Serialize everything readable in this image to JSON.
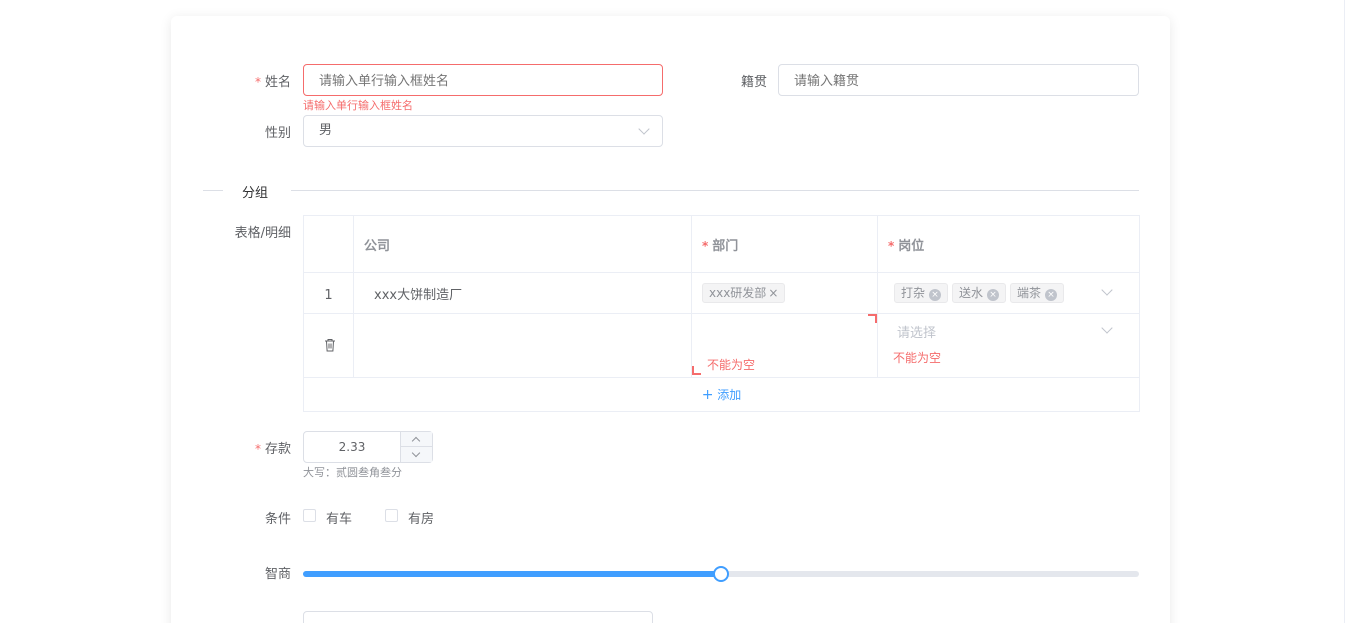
{
  "form": {
    "name": {
      "required_mark": "*",
      "label": "姓名",
      "placeholder": "请输入单行输入框姓名",
      "error": "请输入单行输入框姓名"
    },
    "hometown": {
      "label": "籍贯",
      "placeholder": "请输入籍贯"
    },
    "gender": {
      "label": "性别",
      "value": "男"
    },
    "group_divider": {
      "label": "分组"
    },
    "table": {
      "label": "表格/明细",
      "columns": [
        {
          "label": "公司",
          "required": false
        },
        {
          "label": "部门",
          "required": true,
          "required_mark": "*"
        },
        {
          "label": "岗位",
          "required": true,
          "required_mark": "*"
        }
      ],
      "row1": {
        "index": "1",
        "company": "xxx大饼制造厂",
        "department_tags": [
          "xxx研发部"
        ],
        "position_tags": [
          "打杂",
          "送水",
          "端茶"
        ]
      },
      "row2": {
        "department_error": "不能为空",
        "position_placeholder": "请选择",
        "position_error": "不能为空"
      },
      "add_label": "添加",
      "add_icon": "plus-icon",
      "tag_close_char": "×"
    },
    "deposit": {
      "required_mark": "*",
      "label": "存款",
      "value": "2.33",
      "uppercase_hint": "大写：贰圆叁角叁分"
    },
    "conditions": {
      "label": "条件",
      "options": [
        "有车",
        "有房"
      ]
    },
    "iq": {
      "label": "智商",
      "value_fraction": 0.5
    }
  },
  "colors": {
    "primary": "#409eff",
    "danger": "#f56c6c",
    "border": "#dcdfe6"
  }
}
